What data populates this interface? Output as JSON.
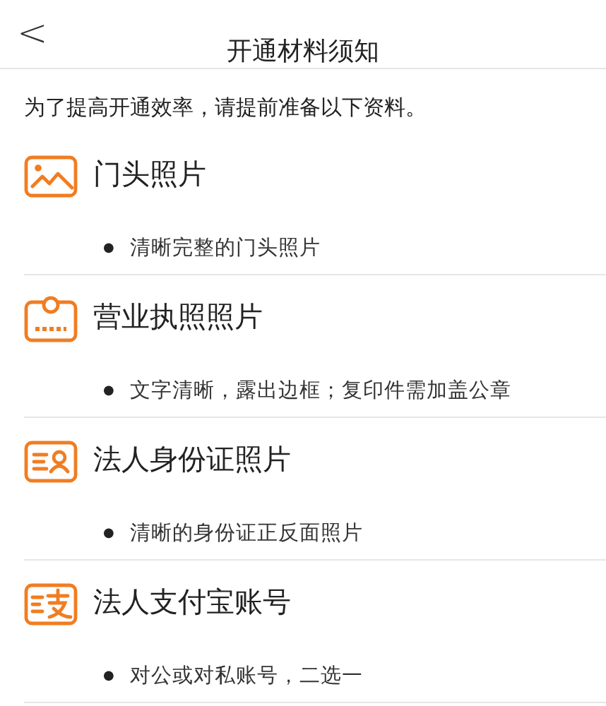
{
  "header": {
    "back": "<",
    "title": "开通材料须知"
  },
  "intro": "为了提高开通效率，请提前准备以下资料。",
  "items": [
    {
      "kind": "photo",
      "title": "门头照片",
      "bullet": "●",
      "note": "清晰完整的门头照片"
    },
    {
      "kind": "license",
      "title": "营业执照照片",
      "bullet": "●",
      "note": "文字清晰，露出边框；复印件需加盖公章"
    },
    {
      "kind": "idcard",
      "title": "法人身份证照片",
      "bullet": "●",
      "note": "清晰的身份证正反面照片"
    },
    {
      "kind": "account",
      "title": "法人支付宝账号",
      "bullet": "●",
      "note": "对公或对私账号，二选一"
    }
  ]
}
